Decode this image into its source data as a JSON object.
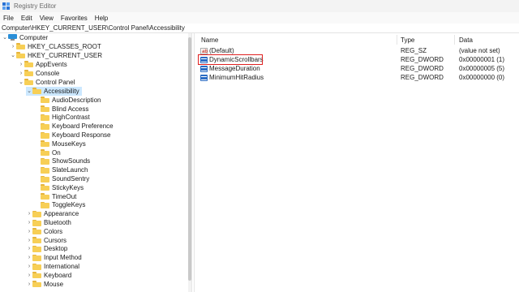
{
  "window": {
    "title": "Registry Editor"
  },
  "menu": [
    "File",
    "Edit",
    "View",
    "Favorites",
    "Help"
  ],
  "address": "Computer\\HKEY_CURRENT_USER\\Control Panel\\Accessibility",
  "tree": {
    "computer": "Computer",
    "hkcr": "HKEY_CLASSES_ROOT",
    "hkcu": "HKEY_CURRENT_USER",
    "appevents": "AppEvents",
    "console": "Console",
    "control_panel": "Control Panel",
    "accessibility": "Accessibility",
    "accessibility_children": [
      "AudioDescription",
      "Blind Access",
      "HighContrast",
      "Keyboard Preference",
      "Keyboard Response",
      "MouseKeys",
      "On",
      "ShowSounds",
      "SlateLaunch",
      "SoundSentry",
      "StickyKeys",
      "TimeOut",
      "ToggleKeys"
    ],
    "control_panel_children": [
      "Appearance",
      "Bluetooth",
      "Colors",
      "Cursors",
      "Desktop",
      "Input Method",
      "International",
      "Keyboard",
      "Mouse"
    ]
  },
  "values": {
    "columns": {
      "name": "Name",
      "type": "Type",
      "data": "Data"
    },
    "rows": [
      {
        "name": "(Default)",
        "type": "REG_SZ",
        "data": "(value not set)",
        "icon": "string-value-icon"
      },
      {
        "name": "DynamicScrollbars",
        "type": "REG_DWORD",
        "data": "0x00000001 (1)",
        "icon": "dword-value-icon"
      },
      {
        "name": "MessageDuration",
        "type": "REG_DWORD",
        "data": "0x00000005 (5)",
        "icon": "dword-value-icon"
      },
      {
        "name": "MinimumHitRadius",
        "type": "REG_DWORD",
        "data": "0x00000000 (0)",
        "icon": "dword-value-icon"
      }
    ]
  },
  "colors": {
    "selection": "#cce8ff",
    "highlight": "#e02020",
    "folder": "#f7cf56"
  }
}
